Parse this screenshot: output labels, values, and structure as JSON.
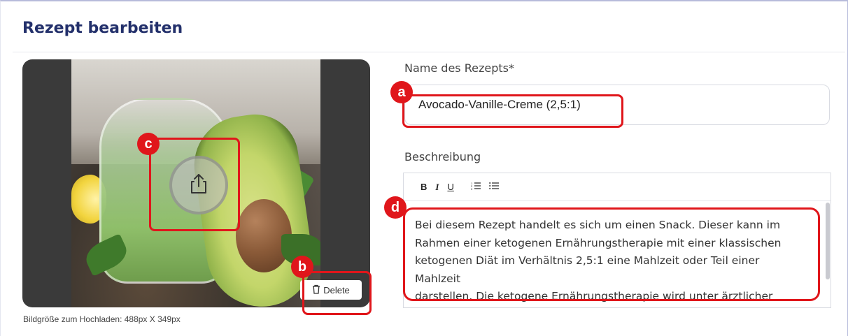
{
  "page": {
    "title": "Rezept bearbeiten"
  },
  "image": {
    "delete_label": "Delete",
    "hint": "Bildgröße zum Hochladen: 488px X 349px",
    "upload_icon": "upload-icon",
    "delete_icon": "trash-icon"
  },
  "form": {
    "name_label": "Name des Rezepts*",
    "name_value": "Avocado-Vanille-Creme (2,5:1)",
    "description_label": "Beschreibung",
    "description_lines": [
      "Bei diesem Rezept handelt es sich um einen Snack. Dieser kann im",
      "Rahmen einer ketogenen Ernährungstherapie mit einer klassischen",
      "ketogenen Diät im Verhältnis 2,5:1 eine Mahlzeit oder Teil einer Mahlzeit",
      "darstellen. Die ketogene Ernährungstherapie wird unter ärztlicher"
    ],
    "toolbar": {
      "bold": "B",
      "italic": "I",
      "underline": "U"
    }
  },
  "annotations": {
    "a": "a",
    "b": "b",
    "c": "c",
    "d": "d"
  },
  "colors": {
    "title": "#23306b",
    "annotation": "#e0161b"
  }
}
